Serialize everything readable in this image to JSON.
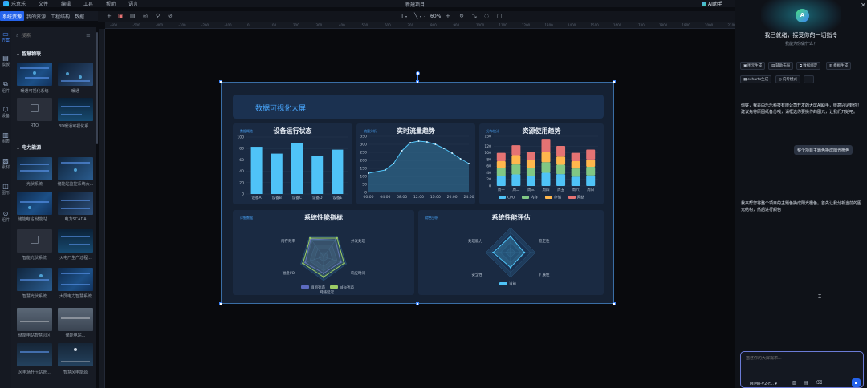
{
  "app": {
    "name": "乐意乐",
    "menu": [
      "文件",
      "编辑",
      "工具",
      "帮助",
      "语言"
    ],
    "project_title": "新建项目",
    "ai_button": "AI助手"
  },
  "sidebar": {
    "tabs": [
      "系统资源",
      "我的资源",
      "工程结构",
      "数据"
    ],
    "icon_tabs": [
      "方案",
      "模板",
      "组件",
      "设备",
      "图表",
      "素材",
      "图形",
      "组件"
    ],
    "search_placeholder": "搜索",
    "sections": [
      {
        "title": "智慧物联",
        "items": [
          "暖通可视化系统",
          "暖通",
          "RTO",
          "3D暖通可视化系..."
        ]
      },
      {
        "title": "电力能源",
        "items": [
          "光伏系统",
          "储能站监控系统大...",
          "储能电站 储能站...",
          "电力SCADA",
          "智能光伏系统",
          "火电厂生产过程...",
          "智慧光伏系统",
          "大屏电力智慧系统",
          "储能电站智慧园区",
          "储能电站...",
          "风电场升压站管...",
          "智慧风电能源"
        ]
      }
    ]
  },
  "toolbar": {
    "zoom": "60%",
    "text_tool": "T",
    "line_tool": "╲"
  },
  "ruler": {
    "labels": [
      "-600",
      "-500",
      "-400",
      "-300",
      "-200",
      "-100",
      "0",
      "100",
      "200",
      "300",
      "400",
      "500",
      "600",
      "700",
      "800",
      "900",
      "1000",
      "1100",
      "1200",
      "1300",
      "1400",
      "1500",
      "1600",
      "1700",
      "1800",
      "1900",
      "2000",
      "2100"
    ]
  },
  "dashboard": {
    "title": "数据可视化大屏",
    "panel1": {
      "tag": "数据概览",
      "title": "设备运行状态",
      "chart_data": {
        "type": "bar",
        "categories": [
          "设备A",
          "设备B",
          "设备C",
          "设备D",
          "设备E"
        ],
        "values": [
          83,
          71,
          89,
          67,
          78
        ],
        "ylim": [
          0,
          100
        ],
        "yticks": [
          0,
          20,
          40,
          60,
          80,
          100
        ],
        "color": "#4fc3f7"
      }
    },
    "panel2": {
      "tag": "流量分析",
      "title": "实时流量趋势",
      "chart_data": {
        "type": "area",
        "categories": [
          "00:00",
          "04:00",
          "08:00",
          "12:00",
          "16:00",
          "20:00",
          "24:00"
        ],
        "x": [
          0,
          4,
          6,
          8,
          10,
          12,
          14,
          16,
          18,
          20,
          22,
          24
        ],
        "values": [
          120,
          140,
          180,
          260,
          310,
          320,
          315,
          300,
          275,
          245,
          210,
          180
        ],
        "ylim": [
          0,
          350
        ],
        "yticks": [
          0,
          50,
          100,
          150,
          200,
          250,
          300,
          350
        ],
        "color": "#4fc3f7"
      }
    },
    "panel3": {
      "tag": "分布统计",
      "title": "资源使用趋势",
      "chart_data": {
        "type": "bar",
        "stacked": true,
        "categories": [
          "周一",
          "周二",
          "周三",
          "周四",
          "周五",
          "周六",
          "周日"
        ],
        "series": [
          {
            "name": "CPU",
            "values": [
              30,
              35,
              30,
              40,
              36,
              28,
              32
            ],
            "color": "#4fc3f7"
          },
          {
            "name": "内存",
            "values": [
              25,
              30,
              25,
              32,
              28,
              25,
              26
            ],
            "color": "#81c784"
          },
          {
            "name": "存储",
            "values": [
              20,
              28,
              24,
              30,
              25,
              22,
              22
            ],
            "color": "#ffb74d"
          },
          {
            "name": "网络",
            "values": [
              25,
              30,
              25,
              38,
              32,
              25,
              30
            ],
            "color": "#e57373"
          }
        ],
        "ylim": [
          0,
          150
        ],
        "yticks": [
          0,
          20,
          40,
          60,
          80,
          100,
          120,
          150
        ],
        "legend": "bottom"
      }
    },
    "panel4": {
      "tag": "详细数据",
      "title": "系统性能指标",
      "chart_data": {
        "type": "radar",
        "axes": [
          "并发处理",
          "响应时间",
          "网络延迟",
          "磁盘I/O",
          "内存效率"
        ],
        "series": [
          {
            "name": "当前状态",
            "values": [
              0.85,
              0.75,
              0.7,
              0.8,
              0.9
            ],
            "color": "#5c6bc0"
          },
          {
            "name": "目标状态",
            "values": [
              0.95,
              0.9,
              0.85,
              0.9,
              0.95
            ],
            "color": "#9ccc65"
          }
        ],
        "legend": "bottom"
      }
    },
    "panel5": {
      "tag": "综合分析",
      "title": "系统性能评估",
      "chart_data": {
        "type": "radar",
        "axes": [
          "稳定性",
          "扩展性",
          "安全性",
          "处理能力"
        ],
        "series": [
          {
            "name": "当前",
            "values": [
              0.65,
              0.55,
              0.6,
              0.7
            ],
            "color": "#4fc3f7"
          }
        ],
        "legend": "bottom"
      }
    }
  },
  "chat": {
    "greeting": "我已就绪，接受你的一切指令",
    "subtitle": "我能为你做什么？",
    "quick_actions": [
      "图元生成",
      "辅助布局",
      "数据绑定",
      "模板生成",
      "echarts生成",
      "向导模式"
    ],
    "messages": [
      {
        "role": "ai",
        "text": "你好，我是由乐乐科技有限公司开发的大屏AI助手，很高兴见到你！建议先将原图纸备份哦，请框选你要操作的图元，让我们开始吧。"
      },
      {
        "role": "user",
        "text": "整个项目主题色换成阳光橙色"
      },
      {
        "role": "ai",
        "text": "我来帮您将整个项目的主题色换成阳光橙色。首先让我分析当前的图元结构，然后进行颜色"
      }
    ],
    "input_placeholder": "描述你的大屏需求...",
    "model": "MiMo-V2-F..."
  }
}
